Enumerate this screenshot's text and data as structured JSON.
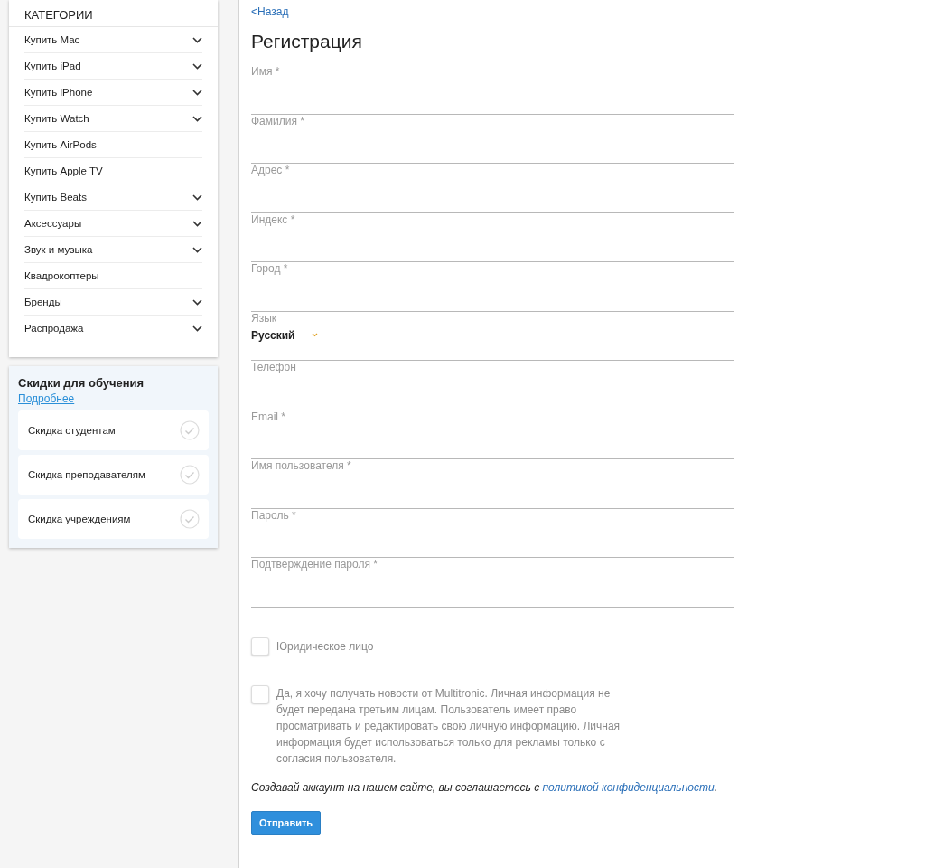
{
  "sidebar": {
    "title": "КАТЕГОРИИ",
    "items": [
      {
        "label": "Купить Mac",
        "expandable": true
      },
      {
        "label": "Купить iPad",
        "expandable": true
      },
      {
        "label": "Купить iPhone",
        "expandable": true
      },
      {
        "label": "Купить Watch",
        "expandable": true
      },
      {
        "label": "Купить AirPods",
        "expandable": false
      },
      {
        "label": "Купить Apple TV",
        "expandable": false
      },
      {
        "label": "Купить Beats",
        "expandable": true
      },
      {
        "label": "Аксессуары",
        "expandable": true
      },
      {
        "label": "Звук и музыка",
        "expandable": true
      },
      {
        "label": "Квадрокоптеры",
        "expandable": false
      },
      {
        "label": "Бренды",
        "expandable": true
      },
      {
        "label": "Распродажа",
        "expandable": true
      }
    ]
  },
  "discounts": {
    "title": "Скидки для обучения",
    "link": "Подробнее",
    "items": [
      {
        "label": "Скидка студентам",
        "checked": false
      },
      {
        "label": "Скидка преподавателям",
        "checked": false
      },
      {
        "label": "Скидка учреждениям",
        "checked": false
      }
    ]
  },
  "form": {
    "back": "<Назад",
    "title": "Регистрация",
    "fields": [
      {
        "kind": "text",
        "label": "Имя *"
      },
      {
        "kind": "text",
        "label": "Фамилия *"
      },
      {
        "kind": "text",
        "label": "Адрес *"
      },
      {
        "kind": "text",
        "label": "Индекс *"
      },
      {
        "kind": "text",
        "label": "Город *"
      },
      {
        "kind": "select",
        "label": "Язык",
        "value": "Русский"
      },
      {
        "kind": "text",
        "label": "Телефон"
      },
      {
        "kind": "text",
        "label": "Email *"
      },
      {
        "kind": "text",
        "label": "Имя пользователя *"
      },
      {
        "kind": "text",
        "label": "Пароль *"
      },
      {
        "kind": "text",
        "label": "Подтверждение пароля *"
      }
    ],
    "legal_entity": {
      "label": "Юридическое лицо",
      "checked": false
    },
    "newsletter": {
      "text": "Да, я хочу получать новости от Multitronic. Личная информация не будет передана третьим лицам. Пользователь имеет право просматривать и редактировать свою личную информацию. Личная информация будет использоваться только для рекламы только с согласия пользователя.",
      "checked": false
    },
    "privacy": {
      "text": "Создавай аккаунт на нашем сайте, вы соглашаетесь с ",
      "link": "политикой конфиденциальности",
      "end": "."
    },
    "submit": "Отправить"
  }
}
